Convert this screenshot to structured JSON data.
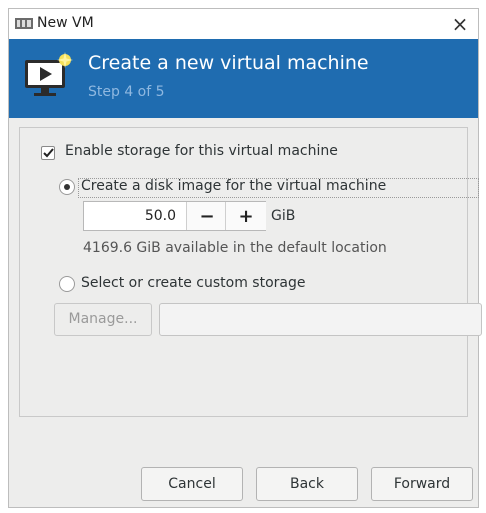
{
  "window": {
    "title": "New VM",
    "close_glyph": "×"
  },
  "banner": {
    "title": "Create a new virtual machine",
    "subtitle": "Step 4 of 5",
    "icon": "monitor-play-icon"
  },
  "storage": {
    "enable_label": "Enable storage for this virtual machine",
    "enable_checked": true,
    "disk_image_label": "Create a disk image for the virtual machine",
    "disk_image_selected": true,
    "size_value": "50.0",
    "size_unit": "GiB",
    "minus_glyph": "−",
    "plus_glyph": "+",
    "available_text": "4169.6 GiB available in the default location",
    "custom_label": "Select or create custom storage",
    "custom_selected": false,
    "manage_label": "Manage...",
    "custom_path_value": ""
  },
  "buttons": {
    "cancel": "Cancel",
    "back": "Back",
    "forward": "Forward"
  }
}
